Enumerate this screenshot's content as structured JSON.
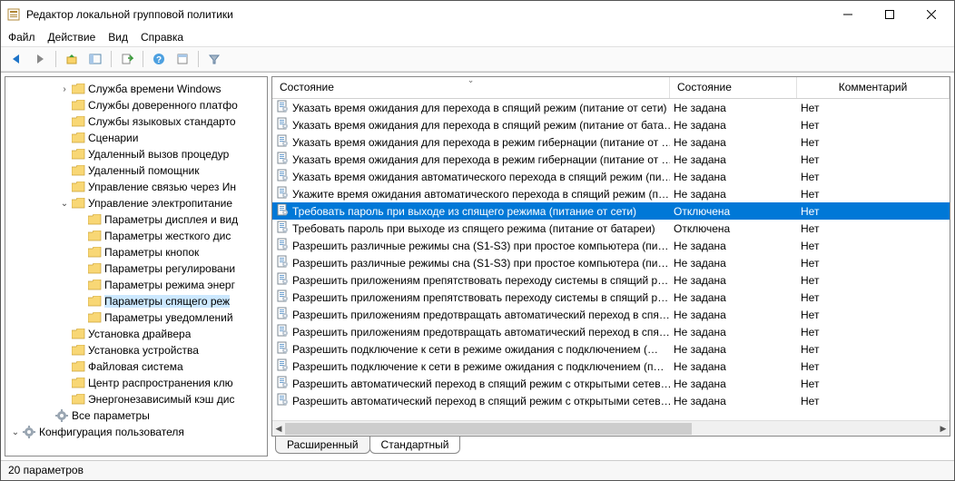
{
  "window": {
    "title": "Редактор локальной групповой политики"
  },
  "menu": {
    "file": "Файл",
    "action": "Действие",
    "view": "Вид",
    "help": "Справка"
  },
  "tree": [
    {
      "depth": 3,
      "exp": ">",
      "type": "folder",
      "label": "Служба времени Windows"
    },
    {
      "depth": 3,
      "exp": "",
      "type": "folder",
      "label": "Службы доверенного платфо"
    },
    {
      "depth": 3,
      "exp": "",
      "type": "folder",
      "label": "Службы языковых стандарто"
    },
    {
      "depth": 3,
      "exp": "",
      "type": "folder",
      "label": "Сценарии"
    },
    {
      "depth": 3,
      "exp": "",
      "type": "folder",
      "label": "Удаленный вызов процедур"
    },
    {
      "depth": 3,
      "exp": "",
      "type": "folder",
      "label": "Удаленный помощник"
    },
    {
      "depth": 3,
      "exp": "",
      "type": "folder",
      "label": "Управление связью через Ин"
    },
    {
      "depth": 3,
      "exp": "v",
      "type": "folder",
      "label": "Управление электропитание"
    },
    {
      "depth": 4,
      "exp": "",
      "type": "folder",
      "label": "Параметры дисплея и вид"
    },
    {
      "depth": 4,
      "exp": "",
      "type": "folder",
      "label": "Параметры жесткого дис"
    },
    {
      "depth": 4,
      "exp": "",
      "type": "folder",
      "label": "Параметры кнопок"
    },
    {
      "depth": 4,
      "exp": "",
      "type": "folder",
      "label": "Параметры регулировани"
    },
    {
      "depth": 4,
      "exp": "",
      "type": "folder",
      "label": "Параметры режима энерг"
    },
    {
      "depth": 4,
      "exp": "",
      "type": "folder",
      "label": "Параметры спящего реж",
      "sel": true
    },
    {
      "depth": 4,
      "exp": "",
      "type": "folder",
      "label": "Параметры уведомлений"
    },
    {
      "depth": 3,
      "exp": "",
      "type": "folder",
      "label": "Установка драйвера"
    },
    {
      "depth": 3,
      "exp": "",
      "type": "folder",
      "label": "Установка устройства"
    },
    {
      "depth": 3,
      "exp": "",
      "type": "folder",
      "label": "Файловая система"
    },
    {
      "depth": 3,
      "exp": "",
      "type": "folder",
      "label": "Центр распространения клю"
    },
    {
      "depth": 3,
      "exp": "",
      "type": "folder",
      "label": "Энергонезависимый кэш дис"
    },
    {
      "depth": 2,
      "exp": "",
      "type": "gear",
      "label": "Все параметры"
    },
    {
      "depth": 0,
      "exp": "v",
      "type": "gear",
      "label": "Конфигурация пользователя"
    }
  ],
  "columns": {
    "name": "Состояние",
    "state": "Состояние",
    "comment": "Комментарий"
  },
  "rows": [
    {
      "name": "Указать время ожидания для перехода в спящий режим (питание от сети)",
      "state": "Не задана",
      "comment": "Нет"
    },
    {
      "name": "Указать время ожидания для перехода в спящий режим (питание от бата…",
      "state": "Не задана",
      "comment": "Нет"
    },
    {
      "name": "Указать время ожидания для перехода в режим гибернации (питание от …",
      "state": "Не задана",
      "comment": "Нет"
    },
    {
      "name": "Указать время ожидания для перехода в режим гибернации (питание от …",
      "state": "Не задана",
      "comment": "Нет"
    },
    {
      "name": "Указать время ожидания автоматического перехода в спящий режим (пи…",
      "state": "Не задана",
      "comment": "Нет"
    },
    {
      "name": "Укажите время ожидания автоматического перехода в спящий режим (п…",
      "state": "Не задана",
      "comment": "Нет"
    },
    {
      "name": "Требовать пароль при выходе из спящего режима (питание от сети)",
      "state": "Отключена",
      "comment": "Нет",
      "sel": true
    },
    {
      "name": "Требовать пароль при выходе из спящего режима (питание от батареи)",
      "state": "Отключена",
      "comment": "Нет"
    },
    {
      "name": "Разрешить различные режимы сна (S1-S3) при простое компьютера (пи…",
      "state": "Не задана",
      "comment": "Нет"
    },
    {
      "name": "Разрешить различные режимы сна (S1-S3) при простое компьютера (пи…",
      "state": "Не задана",
      "comment": "Нет"
    },
    {
      "name": "Разрешить приложениям препятствовать переходу системы в спящий р…",
      "state": "Не задана",
      "comment": "Нет"
    },
    {
      "name": "Разрешить приложениям препятствовать переходу системы в спящий р…",
      "state": "Не задана",
      "comment": "Нет"
    },
    {
      "name": "Разрешить приложениям предотвращать автоматический переход в спя…",
      "state": "Не задана",
      "comment": "Нет"
    },
    {
      "name": "Разрешить приложениям предотвращать автоматический переход в спя…",
      "state": "Не задана",
      "comment": "Нет"
    },
    {
      "name": "Разрешить подключение к сети в режиме ожидания с подключением (…",
      "state": "Не задана",
      "comment": "Нет"
    },
    {
      "name": "Разрешить подключение к сети в режиме ожидания с подключением (п…",
      "state": "Не задана",
      "comment": "Нет"
    },
    {
      "name": "Разрешить автоматический переход в спящий режим с открытыми сетев…",
      "state": "Не задана",
      "comment": "Нет"
    },
    {
      "name": "Разрешить автоматический переход в спящий режим с открытыми сетев…",
      "state": "Не задана",
      "comment": "Нет"
    }
  ],
  "tabs": {
    "extended": "Расширенный",
    "standard": "Стандартный"
  },
  "status": "20 параметров"
}
